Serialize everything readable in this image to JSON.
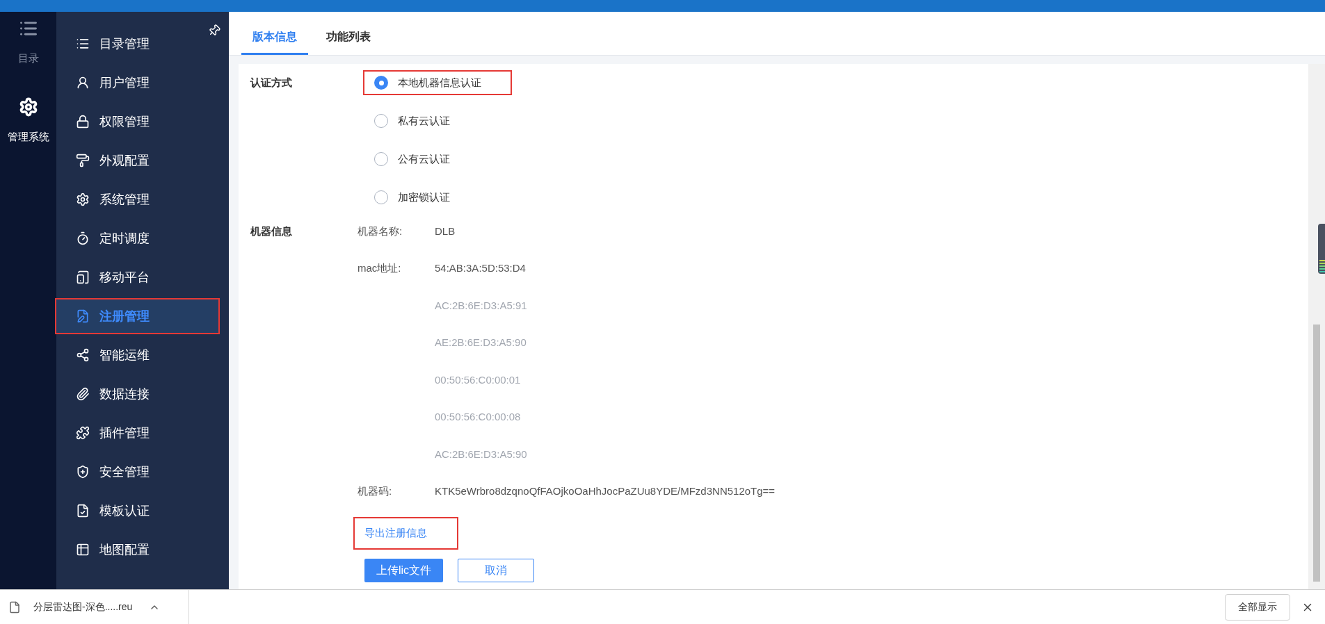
{
  "rail": [
    {
      "label": "目录",
      "selected": false
    },
    {
      "label": "管理系统",
      "selected": true
    }
  ],
  "menu": [
    {
      "label": "目录管理",
      "selected": false,
      "highlighted": false
    },
    {
      "label": "用户管理",
      "selected": false,
      "highlighted": false
    },
    {
      "label": "权限管理",
      "selected": false,
      "highlighted": false
    },
    {
      "label": "外观配置",
      "selected": false,
      "highlighted": false
    },
    {
      "label": "系统管理",
      "selected": false,
      "highlighted": false
    },
    {
      "label": "定时调度",
      "selected": false,
      "highlighted": false
    },
    {
      "label": "移动平台",
      "selected": false,
      "highlighted": false
    },
    {
      "label": "注册管理",
      "selected": true,
      "highlighted": true
    },
    {
      "label": "智能运维",
      "selected": false,
      "highlighted": false
    },
    {
      "label": "数据连接",
      "selected": false,
      "highlighted": false
    },
    {
      "label": "插件管理",
      "selected": false,
      "highlighted": false
    },
    {
      "label": "安全管理",
      "selected": false,
      "highlighted": false
    },
    {
      "label": "模板认证",
      "selected": false,
      "highlighted": false
    },
    {
      "label": "地图配置",
      "selected": false,
      "highlighted": false
    }
  ],
  "tabs": [
    {
      "label": "版本信息",
      "selected": true
    },
    {
      "label": "功能列表",
      "selected": false
    }
  ],
  "auth": {
    "label": "认证方式",
    "options": [
      {
        "label": "本地机器信息认证",
        "selected": true,
        "highlighted": true
      },
      {
        "label": "私有云认证",
        "selected": false,
        "highlighted": false
      },
      {
        "label": "公有云认证",
        "selected": false,
        "highlighted": false
      },
      {
        "label": "加密锁认证",
        "selected": false,
        "highlighted": false
      }
    ]
  },
  "machine": {
    "label": "机器信息",
    "name_label": "机器名称:",
    "name_value": "DLB",
    "mac_label": "mac地址:",
    "macs": [
      {
        "value": "54:AB:3A:5D:53:D4",
        "disabled": false
      },
      {
        "value": "AC:2B:6E:D3:A5:91",
        "disabled": true
      },
      {
        "value": "AE:2B:6E:D3:A5:90",
        "disabled": true
      },
      {
        "value": "00:50:56:C0:00:01",
        "disabled": true
      },
      {
        "value": "00:50:56:C0:00:08",
        "disabled": true
      },
      {
        "value": "AC:2B:6E:D3:A5:90",
        "disabled": true
      }
    ],
    "code_label": "机器码:",
    "code_value": "KTK5eWrbro8dzqnoQfFAOjkoOaHhJocPaZUu8YDE/MFzd3NN512oTg=="
  },
  "export_link": {
    "label": "导出注册信息",
    "highlighted": true
  },
  "buttons": [
    {
      "label": "上传lic文件",
      "kind": "primary"
    },
    {
      "label": "取消",
      "kind": "default"
    }
  ],
  "download_bar": {
    "file": "分层雷达图-深色.....reu",
    "show_all": "全部显示"
  }
}
